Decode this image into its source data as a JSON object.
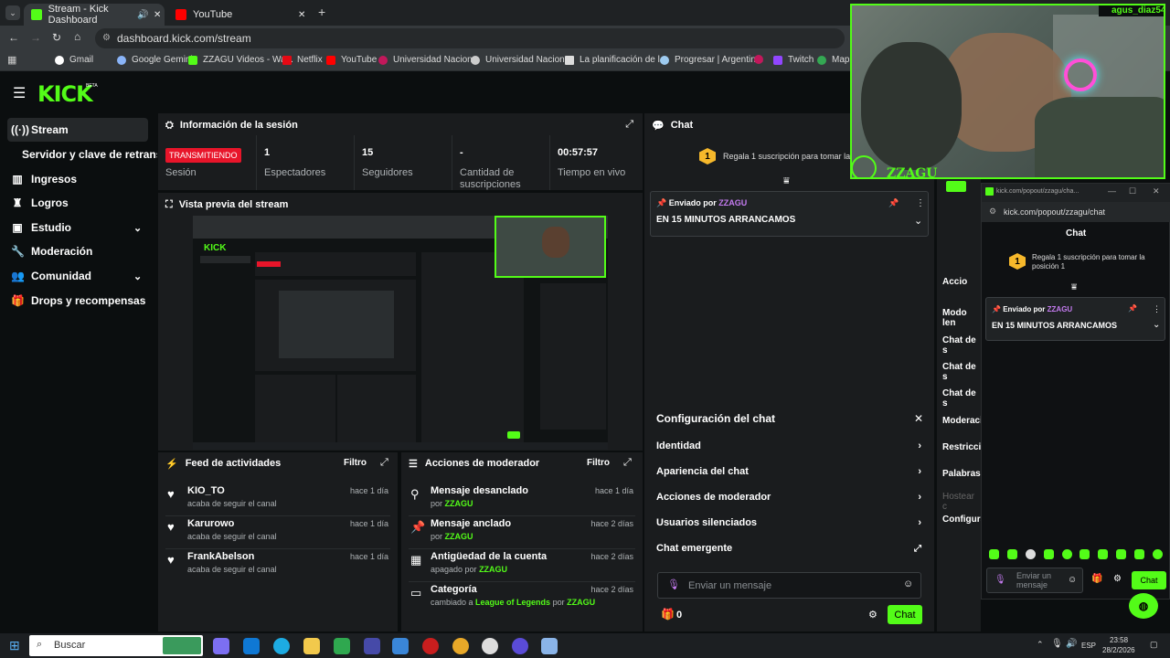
{
  "browser": {
    "tabs": [
      {
        "label": "Stream - Kick Dashboard"
      },
      {
        "label": "YouTube"
      }
    ],
    "url": "dashboard.kick.com/stream",
    "bookmarks": [
      "Gmail",
      "Google Gemini",
      "ZZAGU Videos - Wa...",
      "Netflix",
      "YouTube",
      "Universidad Nacion...",
      "Universidad Nacion...",
      "La planificación de l...",
      "Progresar | Argentin...",
      "Twitch",
      "Map"
    ]
  },
  "header": {
    "logo": "KICK",
    "beta": "BETA"
  },
  "sidebar": {
    "items": [
      {
        "label": "Stream",
        "icon": "broadcast-icon"
      },
      {
        "label": "Servidor y clave de retransm",
        "icon": ""
      },
      {
        "label": "Ingresos",
        "icon": "chart-icon"
      },
      {
        "label": "Logros",
        "icon": "trophy-icon"
      },
      {
        "label": "Estudio",
        "icon": "studio-icon"
      },
      {
        "label": "Moderación",
        "icon": "wrench-icon"
      },
      {
        "label": "Comunidad",
        "icon": "people-icon"
      },
      {
        "label": "Drops y recompensas",
        "icon": "gift-icon"
      }
    ]
  },
  "session": {
    "title": "Información de la sesión",
    "badge": "TRANSMITIENDO",
    "stats": [
      {
        "value": "",
        "label": "Sesión"
      },
      {
        "value": "1",
        "label": "Espectadores"
      },
      {
        "value": "15",
        "label": "Seguidores"
      },
      {
        "value": "-",
        "label": "Cantidad de suscripciones"
      },
      {
        "value": "00:57:57",
        "label": "Tiempo en vivo"
      }
    ]
  },
  "preview": {
    "title": "Vista previa del stream"
  },
  "feed": {
    "title": "Feed de actividades",
    "filter": "Filtro",
    "rows": [
      {
        "name": "KIO_TO",
        "sub": "acaba de seguir el canal",
        "time": "hace 1 día"
      },
      {
        "name": "Karurowo",
        "sub": "acaba de seguir el canal",
        "time": "hace 1 día"
      },
      {
        "name": "FrankAbelson",
        "sub": "acaba de seguir el canal",
        "time": "hace 1 día"
      }
    ]
  },
  "modactions": {
    "title": "Acciones de moderador",
    "filter": "Filtro",
    "rows": [
      {
        "name": "Mensaje desanclado",
        "pre": "por",
        "user": "ZZAGU",
        "mid": "",
        "post": "",
        "time": "hace 1 día"
      },
      {
        "name": "Mensaje anclado",
        "pre": "por",
        "user": "ZZAGU",
        "mid": "",
        "post": "",
        "time": "hace 2 días"
      },
      {
        "name": "Antigüedad de la cuenta",
        "pre": "apagado por",
        "user": "ZZAGU",
        "mid": "",
        "post": "",
        "time": "hace 2 días"
      },
      {
        "name": "Categoría",
        "pre": "cambiado a",
        "user": "League of Legends",
        "mid": "por",
        "post": "ZZAGU",
        "time": "hace 2 días"
      }
    ]
  },
  "chat": {
    "title": "Chat",
    "gift_text": "Regala 1 suscripción para tomar la",
    "gift_num": "1",
    "pinned_by": "Enviado por",
    "pinned_user": "ZZAGU",
    "pinned_msg": "EN 15 MINUTOS ARRANCAMOS",
    "config_title": "Configuración del chat",
    "config_items": [
      "Identidad",
      "Apariencia del chat",
      "Acciones de moderador",
      "Usuarios silenciados",
      "Chat emergente"
    ],
    "input_placeholder": "Enviar un mensaje",
    "count": "0",
    "send": "Chat"
  },
  "right_panel": {
    "title": "Accio",
    "items": [
      "Modo len",
      "Chat de s",
      "Chat de s",
      "Chat de s",
      "Moderaci",
      "Restricci",
      "Palabras",
      "Hostear c",
      "Configura"
    ]
  },
  "popout": {
    "url_top": "kick.com/popout/zzagu/cha...",
    "url": "kick.com/popout/zzagu/chat",
    "title": "Chat",
    "gift_num": "1",
    "gift_text": "Regala 1 suscripción para tomar la posición 1",
    "pinned_by": "Enviado por",
    "pinned_user": "ZZAGU",
    "pinned_msg": "EN 15 MINUTOS ARRANCAMOS",
    "input_placeholder": "Enviar un mensaje",
    "send": "Chat"
  },
  "webcam": {
    "username": "agus_diaz54",
    "overlay": "ZZAGU"
  },
  "taskbar": {
    "search": "Buscar",
    "lang": "ESP",
    "time": "23:58",
    "date": "28/2/2026"
  },
  "colors": {
    "accent": "#53fc18",
    "badge": "#e8152a",
    "panel": "#1a1c1e"
  }
}
